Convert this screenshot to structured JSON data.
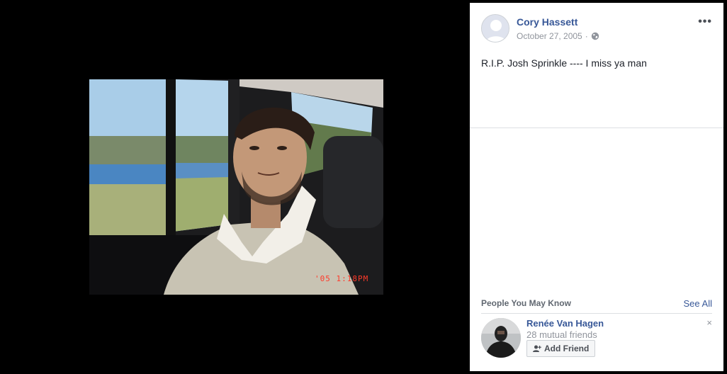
{
  "post": {
    "author": "Cory Hassett",
    "date": "October 27, 2005",
    "separator": "·",
    "privacy_icon": "globe-icon",
    "more_label": "•••",
    "text": "R.I.P. Josh Sprinkle ---- I miss ya man",
    "photo_stamp": "'05  1:18PM"
  },
  "pymk": {
    "title": "People You May Know",
    "see_all": "See All",
    "person": {
      "name": "Renée Van Hagen",
      "mutual": "28 mutual friends",
      "add_label": "Add Friend",
      "dismiss_label": "×"
    }
  },
  "colors": {
    "link": "#385898",
    "muted": "#90949c",
    "viewer_bg": "#000000"
  }
}
